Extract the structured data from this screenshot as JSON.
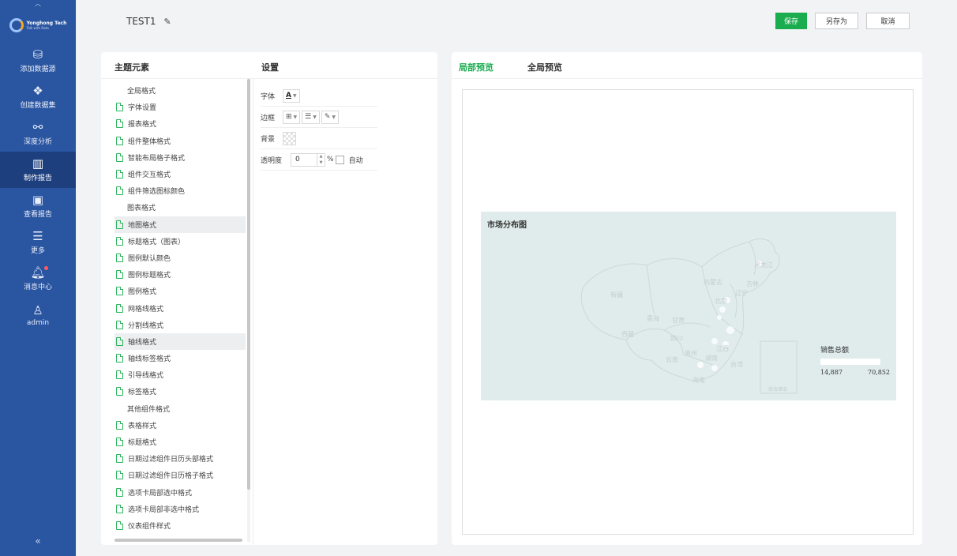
{
  "brand": {
    "name": "Yonghong Tech",
    "tagline": "Talk with Data",
    "logo_accent": "#f5a623"
  },
  "sidebar": {
    "items": [
      {
        "label": "添加数据源",
        "icon": "database-icon"
      },
      {
        "label": "创建数据集",
        "icon": "layers-icon"
      },
      {
        "label": "深度分析",
        "icon": "analysis-nodes-icon"
      },
      {
        "label": "制作报告",
        "icon": "report-chart-icon",
        "active": true
      },
      {
        "label": "查看报告",
        "icon": "view-report-icon"
      },
      {
        "label": "更多",
        "icon": "menu-icon"
      },
      {
        "label": "消息中心",
        "icon": "bell-icon",
        "has_notification": true
      },
      {
        "label": "admin",
        "icon": "user-icon"
      }
    ],
    "collapse_top": "︿",
    "collapse_bottom": "«",
    "bg_color": "#2a55a1"
  },
  "header": {
    "title": "TEST1",
    "edit_icon": "pencil-icon",
    "buttons": {
      "save": "保存",
      "save_as": "另存为",
      "cancel": "取消"
    },
    "save_color": "#1aad4f"
  },
  "left_panel": {
    "col_theme": "主题元素",
    "col_settings": "设置",
    "groups": [
      {
        "title": "全局格式",
        "items": [
          "字体设置",
          "报表格式",
          "组件整体格式",
          "智能布局格子格式",
          "组件交互格式",
          "组件筛选图标颜色"
        ]
      },
      {
        "title": "图表格式",
        "items": [
          "地图格式",
          "标题格式（图表）",
          "图例默认颜色",
          "图例标题格式",
          "图例格式",
          "网格线格式",
          "分割线格式",
          "轴线格式",
          "轴线标签格式",
          "引导线格式",
          "标签格式"
        ]
      },
      {
        "title": "其他组件格式",
        "items": [
          "表格样式",
          "标题格式",
          "日期过滤组件日历头部格式",
          "日期过滤组件日历格子格式",
          "选项卡局部选中格式",
          "选项卡局部非选中格式",
          "仪表组件样式"
        ]
      }
    ],
    "selected_item": "地图格式",
    "hovered_item": "轴线格式",
    "settings": {
      "font_label": "字体",
      "font_value": "A",
      "border_label": "边框",
      "background_label": "背景",
      "opacity_label": "透明度",
      "opacity_value": "0",
      "opacity_unit": "%",
      "auto_label": "自动"
    }
  },
  "right_panel": {
    "tabs": [
      "局部预览",
      "全局预览"
    ],
    "active_tab": "局部预览",
    "map": {
      "title": "市场分布图",
      "regions": [
        "新疆",
        "西藏",
        "青海",
        "甘肃",
        "四川",
        "内蒙古",
        "黑龙江",
        "吉林",
        "辽宁",
        "北京",
        "云南",
        "贵州",
        "湖南",
        "江西",
        "台湾",
        "海南",
        "南海诸岛"
      ],
      "legend_title": "销售总额",
      "legend_min": "14,887",
      "legend_max": "70,852",
      "bg_color": "#dfeceb"
    }
  }
}
